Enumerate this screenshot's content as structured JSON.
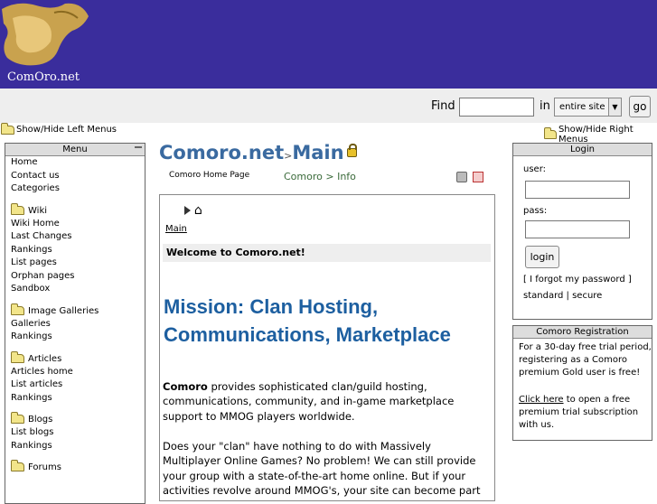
{
  "header": {
    "logo_text": "ComOro.net"
  },
  "search": {
    "find_label": "Find",
    "in_label": "in",
    "scope_value": "entire site",
    "go_label": "go",
    "query_value": ""
  },
  "toggles": {
    "left": "Show/Hide Left Menus",
    "right": "Show/Hide Right Menus"
  },
  "left_menu": {
    "title": "Menu",
    "top_items": [
      "Home",
      "Contact us",
      "Categories"
    ],
    "sections": [
      {
        "title": "Wiki",
        "items": [
          "Wiki Home",
          "Last Changes",
          "Rankings",
          "List pages",
          "Orphan pages",
          "Sandbox"
        ]
      },
      {
        "title": "Image Galleries",
        "items": [
          "Galleries",
          "Rankings"
        ]
      },
      {
        "title": "Articles",
        "items": [
          "Articles home",
          "List articles",
          "Rankings"
        ]
      },
      {
        "title": "Blogs",
        "items": [
          "List blogs",
          "Rankings"
        ]
      },
      {
        "title": "Forums",
        "items": []
      }
    ]
  },
  "page": {
    "title_site": "Comoro.net",
    "title_sep": ">",
    "title_page": "Main",
    "description": "Comoro Home Page",
    "crumbs": "Comoro > Info",
    "main_link": "Main",
    "welcome": "Welcome to Comoro.net!",
    "mission": "Mission: Clan Hosting, Communications, Marketplace",
    "p1_bold": "Comoro",
    "p1_rest": " provides sophisticated clan/guild hosting, communications, community, and in-game marketplace support to MMOG players worldwide.",
    "p2": "Does your \"clan\" have nothing to do with Massively Multiplayer Online Games? No problem! We can still provide your group with a state-of-the-art home online. But if your activities revolve around MMOG's, your site can become part of our gamers' Tiki ring and"
  },
  "login": {
    "title": "Login",
    "user_label": "user:",
    "pass_label": "pass:",
    "button": "login",
    "forgot": "[ I forgot my password ]",
    "std_secure": "standard | secure"
  },
  "registration": {
    "title": "Comoro Registration",
    "text1": "For a 30-day free trial period, registering as a Comoro premium Gold user is free!",
    "link": "Click here",
    "text2": " to open a free premium trial subscription with us."
  }
}
